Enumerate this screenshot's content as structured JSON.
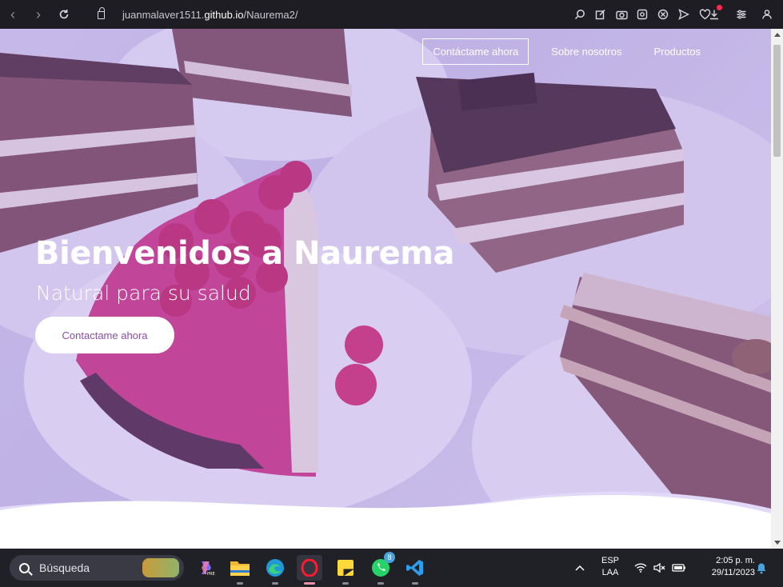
{
  "browser": {
    "url_prefix": "juanmalaver1511.",
    "url_host": "github.io",
    "url_path": "/Naurema2/",
    "nav_icons": [
      "back-arrow-icon",
      "forward-arrow-icon",
      "reload-icon",
      "lock-icon"
    ],
    "tool_icons": [
      "search-icon",
      "edit-icon",
      "camera-icon",
      "extension-icon",
      "block-icon",
      "send-icon",
      "heart-icon",
      "download-icon",
      "settings-icon",
      "profile-icon"
    ]
  },
  "page": {
    "nav": {
      "contact_label": "Contáctame ahora",
      "about_label": "Sobre nosotros",
      "products_label": "Productos"
    },
    "hero": {
      "title": "Bienvenidos a Naurema",
      "subtitle": "Natural para su salud",
      "cta_label": "Contactame ahora"
    }
  },
  "taskbar": {
    "search_placeholder": "Búsqueda",
    "apps": [
      "copilot-icon",
      "file-explorer-icon",
      "edge-icon",
      "opera-icon",
      "sticky-notes-icon",
      "whatsapp-icon",
      "vscode-icon"
    ],
    "whatsapp_badge": "8",
    "lang_line1": "ESP",
    "lang_line2": "LAA",
    "time": "2:05 p. m.",
    "date": "29/11/2023"
  },
  "colors": {
    "overlay": "#9678e6",
    "cta_text": "#8a4fa3",
    "taskbar": "#202027"
  }
}
